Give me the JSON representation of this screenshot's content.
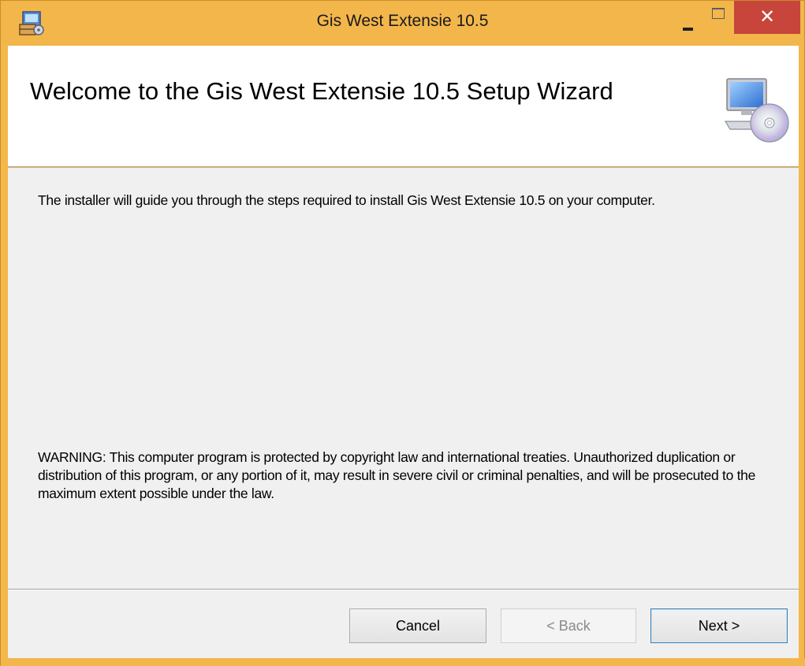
{
  "window": {
    "title": "Gis West Extensie 10.5",
    "close_glyph": "✕",
    "frame_color": "#f2b64b",
    "close_color": "#c7453a"
  },
  "banner": {
    "title": "Welcome to the Gis West Extensie 10.5 Setup Wizard",
    "icon": "computer-cd-icon"
  },
  "body": {
    "intro": "The installer will guide you through the steps required to install Gis West Extensie 10.5 on your computer.",
    "warning": "WARNING: This computer program is protected by copyright law and international treaties. Unauthorized duplication or distribution of this program, or any portion of it, may result in severe civil or criminal penalties, and will be prosecuted to the maximum extent possible under the law."
  },
  "buttons": {
    "cancel": "Cancel",
    "back": "< Back",
    "next": "Next >"
  },
  "icons": {
    "app": "installer-package-icon",
    "minimize": "minimize-icon",
    "maximize": "maximize-icon",
    "close": "close-icon"
  }
}
